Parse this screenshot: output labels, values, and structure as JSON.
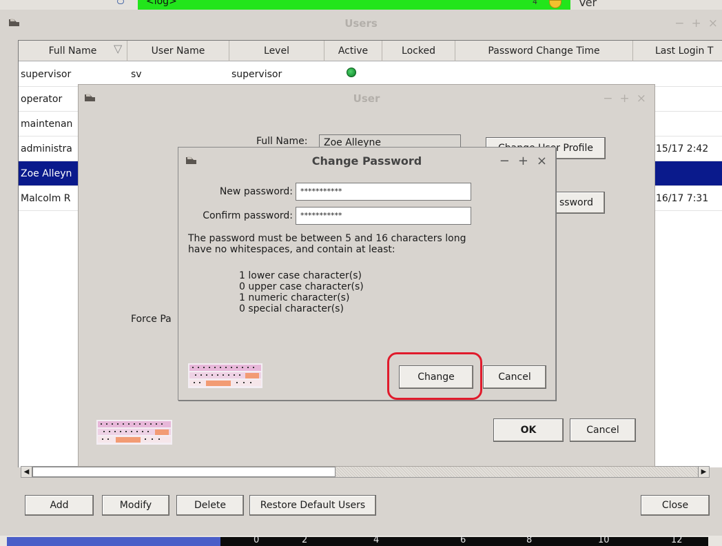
{
  "top_strip": {
    "log_label": "<log>",
    "ver_label": "Ver",
    "pct_label": "4"
  },
  "users_window": {
    "title": "Users",
    "wm_buttons": [
      "−",
      "+",
      "×"
    ],
    "columns": [
      "Full Name",
      "User Name",
      "Level",
      "Active",
      "Locked",
      "Password Change Time",
      "Last Login T"
    ],
    "sort_indicator": "▽",
    "rows": [
      {
        "full_name": "supervisor",
        "user_name": "sv",
        "level": "supervisor",
        "active": true,
        "last_login": ""
      },
      {
        "full_name": "operator",
        "user_name": "",
        "level": "",
        "active": false,
        "last_login": ""
      },
      {
        "full_name": "maintenan",
        "user_name": "",
        "level": "",
        "active": false,
        "last_login": ""
      },
      {
        "full_name": "administra",
        "user_name": "",
        "level": "",
        "active": false,
        "last_login": "15/17 2:42"
      },
      {
        "full_name": "Zoe Alleyn",
        "user_name": "",
        "level": "",
        "active": false,
        "last_login": "",
        "selected": true
      },
      {
        "full_name": "Malcolm R",
        "user_name": "",
        "level": "",
        "active": false,
        "last_login": "16/17 7:31"
      }
    ],
    "buttons": {
      "add": "Add",
      "modify": "Modify",
      "delete": "Delete",
      "restore": "Restore Default Users",
      "close": "Close"
    },
    "scroll_left": "◀",
    "scroll_right": "▶"
  },
  "bottom_axis": {
    "ticks": [
      "0",
      "2",
      "4",
      "6",
      "8",
      "10",
      "12"
    ]
  },
  "user_dialog": {
    "title": "User",
    "wm_buttons": [
      "−",
      "+",
      "×"
    ],
    "full_name_label": "Full Name:",
    "full_name_value": "Zoe Alleyne",
    "change_profile_button": "Change User Profile",
    "change_password_button": "ssword",
    "force_label": "Force Pa",
    "ok_button": "OK",
    "cancel_button": "Cancel"
  },
  "change_password_dialog": {
    "title": "Change Password",
    "wm_buttons": [
      "−",
      "+",
      "×"
    ],
    "new_password_label": "New password:",
    "new_password_value": "***********",
    "confirm_password_label": "Confirm password:",
    "confirm_password_value": "***********",
    "rule_intro_1": "The password must be between 5 and 16 characters long",
    "rule_intro_2": "have no whitespaces, and contain at least:",
    "requirements": [
      "1 lower case character(s)",
      "0 upper case character(s)",
      "1 numeric character(s)",
      "0 special character(s)"
    ],
    "change_button": "Change",
    "cancel_button": "Cancel"
  },
  "colors": {
    "selection": "#0a1a8c",
    "highlight": "#e01b2c",
    "active_dot": "#1a9a38"
  }
}
